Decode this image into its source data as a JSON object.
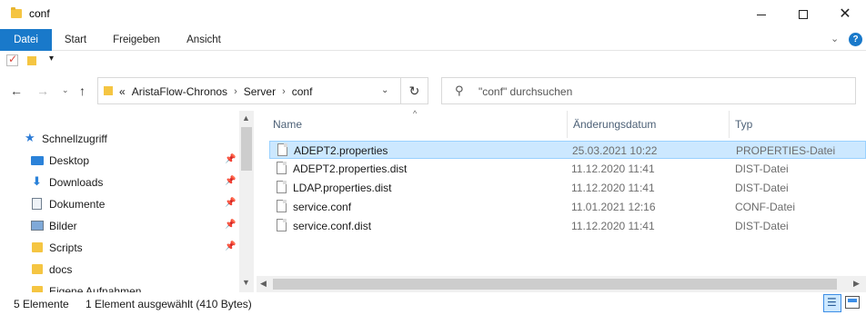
{
  "window": {
    "title": "conf",
    "minimize": "─",
    "close": "✕"
  },
  "ribbon": {
    "tabs": [
      "Datei",
      "Start",
      "Freigeben",
      "Ansicht"
    ],
    "expand_chevron": "⌄",
    "help": "?"
  },
  "address": {
    "overflow": "«",
    "crumbs": [
      "AristaFlow-Chronos",
      "Server",
      "conf"
    ],
    "separator": "›",
    "dropdown": "⌄",
    "refresh": "↻"
  },
  "search": {
    "placeholder": "\"conf\" durchsuchen",
    "icon": "search-icon"
  },
  "nav_buttons": {
    "back": "←",
    "forward": "→",
    "recent": "⌄",
    "up": "↑"
  },
  "sidebar": {
    "items": [
      {
        "label": "Schnellzugriff",
        "icon": "star-icon",
        "pinned": false
      },
      {
        "label": "Desktop",
        "icon": "desktop-icon",
        "pinned": true
      },
      {
        "label": "Downloads",
        "icon": "download-icon",
        "pinned": true
      },
      {
        "label": "Dokumente",
        "icon": "documents-icon",
        "pinned": true
      },
      {
        "label": "Bilder",
        "icon": "pictures-icon",
        "pinned": true
      },
      {
        "label": "Scripts",
        "icon": "folder-icon",
        "pinned": true
      },
      {
        "label": "docs",
        "icon": "folder-icon",
        "pinned": false
      },
      {
        "label": "Eigene Aufnahmen",
        "icon": "folder-icon",
        "pinned": false
      }
    ],
    "pin_glyph": "📌"
  },
  "columns": {
    "name": "Name",
    "date": "Änderungsdatum",
    "type": "Typ"
  },
  "files": [
    {
      "name": "ADEPT2.properties",
      "date": "25.03.2021 10:22",
      "type": "PROPERTIES-Datei",
      "selected": true
    },
    {
      "name": "ADEPT2.properties.dist",
      "date": "11.12.2020 11:41",
      "type": "DIST-Datei",
      "selected": false
    },
    {
      "name": "LDAP.properties.dist",
      "date": "11.12.2020 11:41",
      "type": "DIST-Datei",
      "selected": false
    },
    {
      "name": "service.conf",
      "date": "11.01.2021 12:16",
      "type": "CONF-Datei",
      "selected": false
    },
    {
      "name": "service.conf.dist",
      "date": "11.12.2020 11:41",
      "type": "DIST-Datei",
      "selected": false
    }
  ],
  "status": {
    "count": "5 Elemente",
    "selection": "1 Element ausgewählt (410 Bytes)"
  },
  "colors": {
    "accent": "#1979ca",
    "selection_bg": "#cce8ff",
    "selection_border": "#99d1ff",
    "folder": "#f5c542"
  }
}
